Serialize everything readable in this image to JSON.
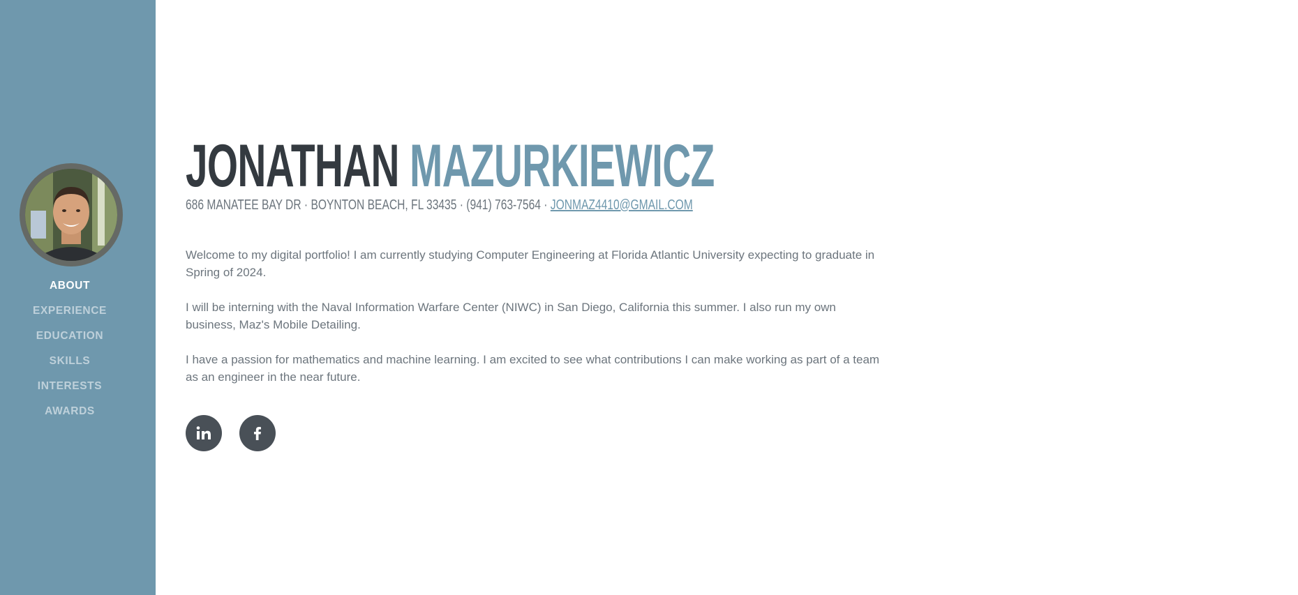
{
  "nav": {
    "items": [
      {
        "label": "ABOUT",
        "active": true
      },
      {
        "label": "EXPERIENCE",
        "active": false
      },
      {
        "label": "EDUCATION",
        "active": false
      },
      {
        "label": "SKILLS",
        "active": false
      },
      {
        "label": "INTERESTS",
        "active": false
      },
      {
        "label": "AWARDS",
        "active": false
      }
    ]
  },
  "about": {
    "first_name": "JONATHAN",
    "last_name": "MAZURKIEWICZ",
    "address": "686 MANATEE BAY DR · BOYNTON BEACH, FL 33435 · (941) 763-7564 · ",
    "email": "JONMAZ4410@GMAIL.COM",
    "paragraphs": [
      "Welcome to my digital portfolio! I am currently studying Computer Engineering at Florida Atlantic University expecting to graduate in Spring of 2024.",
      "I will be interning with the Naval Information Warfare Center (NIWC) in San Diego, California this summer. I also run my own business, Maz's Mobile Detailing.",
      "I have a passion for mathematics and machine learning. I am excited to see what contributions I can make working as part of a team as an engineer in the near future."
    ]
  },
  "social": {
    "icons": [
      "linkedin-icon",
      "facebook-icon"
    ]
  },
  "colors": {
    "sidebar": "#6f98ad",
    "accent": "#6f98ad",
    "dark": "#343a40",
    "text": "#6c757d",
    "social_bg": "#495057"
  }
}
